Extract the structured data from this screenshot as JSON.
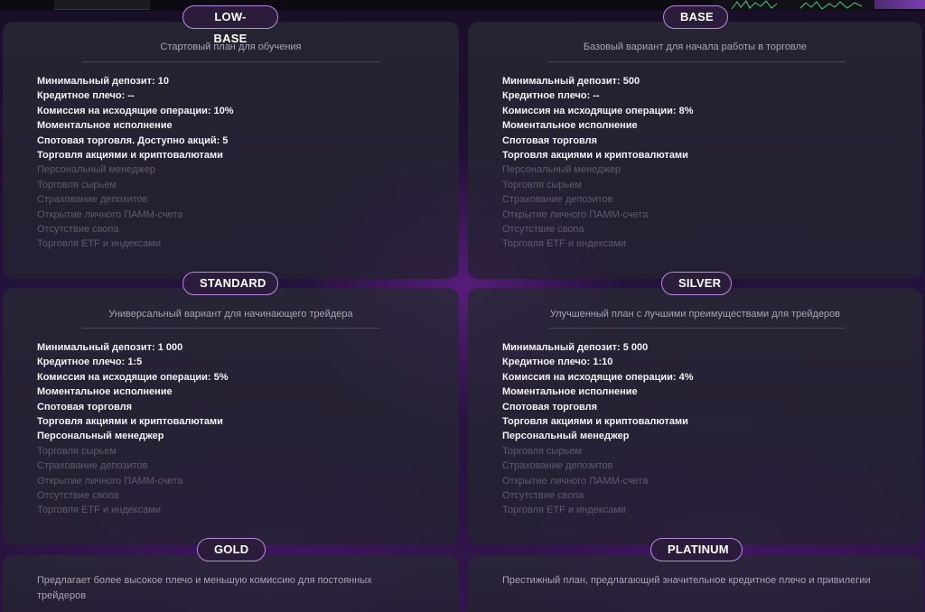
{
  "plans": [
    {
      "name": "LOW-BASE",
      "subtitle": "Стартовый план для обучения",
      "features": [
        {
          "text": "Минимальный депозит: 10",
          "active": true
        },
        {
          "text": "Кредитное плечо: --",
          "active": true
        },
        {
          "text": "Комиссия на исходящие операции: 10%",
          "active": true
        },
        {
          "text": "Моментальное исполнение",
          "active": true
        },
        {
          "text": "Спотовая торговля. Доступно акций: 5",
          "active": true
        },
        {
          "text": "Торговля акциями и криптовалютами",
          "active": true
        },
        {
          "text": "Персональный менеджер",
          "active": false
        },
        {
          "text": "Торговля сырьем",
          "active": false
        },
        {
          "text": "Страхование депозитов",
          "active": false
        },
        {
          "text": "Открытие личного ПАММ-счета",
          "active": false
        },
        {
          "text": "Отсутствие свопа",
          "active": false
        },
        {
          "text": "Торговля ETF и индексами",
          "active": false
        }
      ]
    },
    {
      "name": "BASE",
      "subtitle": "Базовый вариант для начала работы в торговле",
      "features": [
        {
          "text": "Минимальный депозит: 500",
          "active": true
        },
        {
          "text": "Кредитное плечо: --",
          "active": true
        },
        {
          "text": "Комиссия на исходящие операции: 8%",
          "active": true
        },
        {
          "text": "Моментальное исполнение",
          "active": true
        },
        {
          "text": "Спотовая торговля",
          "active": true
        },
        {
          "text": "Торговля акциями и криптовалютами",
          "active": true
        },
        {
          "text": "Персональный менеджер",
          "active": false
        },
        {
          "text": "Торговля сырьем",
          "active": false
        },
        {
          "text": "Страхование депозитов",
          "active": false
        },
        {
          "text": "Открытие личного ПАММ-счета",
          "active": false
        },
        {
          "text": "Отсутствие свопа",
          "active": false
        },
        {
          "text": "Торговля ETF и индексами",
          "active": false
        }
      ]
    },
    {
      "name": "STANDARD",
      "subtitle": "Универсальный вариант для начинающего трейдера",
      "features": [
        {
          "text": "Минимальный депозит: 1 000",
          "active": true
        },
        {
          "text": "Кредитное плечо: 1:5",
          "active": true
        },
        {
          "text": "Комиссия на исходящие операции: 5%",
          "active": true
        },
        {
          "text": "Моментальное исполнение",
          "active": true
        },
        {
          "text": "Спотовая торговля",
          "active": true
        },
        {
          "text": "Торговля акциями и криптовалютами",
          "active": true
        },
        {
          "text": "Персональный менеджер",
          "active": true
        },
        {
          "text": "Торговля сырьем",
          "active": false
        },
        {
          "text": "Страхование депозитов",
          "active": false
        },
        {
          "text": "Открытие личного ПАММ-счета",
          "active": false
        },
        {
          "text": "Отсутствие свопа",
          "active": false
        },
        {
          "text": "Торговля ETF и индексами",
          "active": false
        }
      ]
    },
    {
      "name": "SILVER",
      "subtitle": "Улучшенный план с лучшими преимуществами для трейдеров",
      "features": [
        {
          "text": "Минимальный депозит: 5 000",
          "active": true
        },
        {
          "text": "Кредитное плечо: 1:10",
          "active": true
        },
        {
          "text": "Комиссия на исходящие операции: 4%",
          "active": true
        },
        {
          "text": "Моментальное исполнение",
          "active": true
        },
        {
          "text": "Спотовая торговля",
          "active": true
        },
        {
          "text": "Торговля акциями и криптовалютами",
          "active": true
        },
        {
          "text": "Персональный менеджер",
          "active": true
        },
        {
          "text": "Торговля сырьем",
          "active": false
        },
        {
          "text": "Страхование депозитов",
          "active": false
        },
        {
          "text": "Открытие личного ПАММ-счета",
          "active": false
        },
        {
          "text": "Отсутствие свопа",
          "active": false
        },
        {
          "text": "Торговля ETF и индексами",
          "active": false
        }
      ]
    },
    {
      "name": "GOLD",
      "description": "Предлагает более высокое плечо и меньшую комиссию для постоянных трейдеров"
    },
    {
      "name": "PLATINUM",
      "description": "Престижный план, предлагающий значительное кредитное плечо и привилегии"
    }
  ]
}
